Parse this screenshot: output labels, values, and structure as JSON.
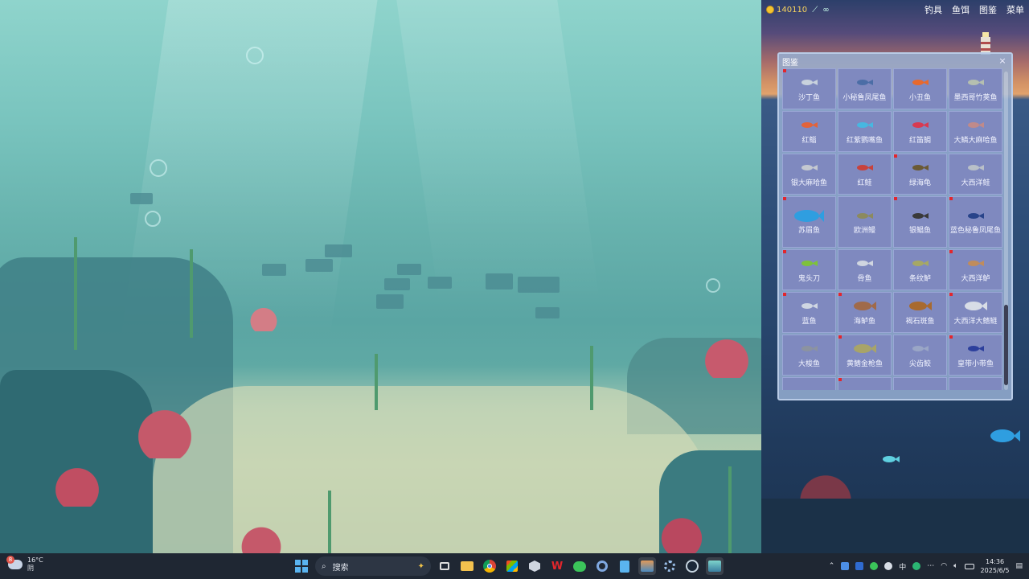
{
  "hud": {
    "gold": "140110",
    "bait_count": "∞",
    "menu": [
      "钓具",
      "鱼饵",
      "图鉴",
      "菜单"
    ]
  },
  "collection": {
    "title": "图鉴",
    "close_label": "×",
    "fish": [
      {
        "name": "沙丁鱼",
        "new": true,
        "icon": "sardine",
        "color": "#c9d2dd"
      },
      {
        "name": "小秘鲁凤尾鱼",
        "new": false,
        "icon": "anchovy",
        "color": "#4b6da6"
      },
      {
        "name": "小丑鱼",
        "new": false,
        "icon": "clownfish",
        "color": "#e8692c"
      },
      {
        "name": "墨西哥竹荚鱼",
        "new": false,
        "icon": "mackerel",
        "color": "#b5bfb0"
      },
      {
        "name": "红鲻",
        "new": false,
        "icon": "red-mullet",
        "color": "#e2633a"
      },
      {
        "name": "红紫鹦嘴鱼",
        "new": false,
        "icon": "parrotfish",
        "color": "#47b7e0"
      },
      {
        "name": "红笛鲷",
        "new": false,
        "icon": "snapper",
        "color": "#d83a52"
      },
      {
        "name": "大鳞大麻哈鱼",
        "new": false,
        "icon": "chinook-salmon",
        "color": "#c08a8a"
      },
      {
        "name": "银大麻哈鱼",
        "new": false,
        "icon": "coho-salmon",
        "color": "#c4c8d0"
      },
      {
        "name": "红鲑",
        "new": false,
        "icon": "sockeye",
        "color": "#c8423c"
      },
      {
        "name": "绿海龟",
        "new": true,
        "icon": "green-turtle",
        "color": "#6b5a34"
      },
      {
        "name": "大西洋鲑",
        "new": false,
        "icon": "atlantic-salmon",
        "color": "#b9c0c8"
      },
      {
        "name": "苏眉鱼",
        "new": true,
        "icon": "napoleon-wrasse",
        "color": "#2f9ee0"
      },
      {
        "name": "欧洲鳗",
        "new": false,
        "icon": "eel",
        "color": "#8c8a5e"
      },
      {
        "name": "银鲳鱼",
        "new": true,
        "icon": "pomfret",
        "color": "#3a3a3a"
      },
      {
        "name": "蓝色秘鲁凤尾鱼",
        "new": true,
        "icon": "blue-anchovy",
        "color": "#28448a"
      },
      {
        "name": "鬼头刀",
        "new": true,
        "icon": "mahi-mahi",
        "color": "#7ec23a"
      },
      {
        "name": "骨鱼",
        "new": false,
        "icon": "bonefish",
        "color": "#d0d6e0"
      },
      {
        "name": "条纹鲈",
        "new": false,
        "icon": "striped-bass",
        "color": "#a6a864"
      },
      {
        "name": "大西洋鲈",
        "new": true,
        "icon": "atlantic-bass",
        "color": "#c08c5c"
      },
      {
        "name": "蓝鱼",
        "new": true,
        "icon": "bluefish",
        "color": "#cfd6e2"
      },
      {
        "name": "海鲈鱼",
        "new": true,
        "icon": "sea-bass",
        "color": "#a06a4a"
      },
      {
        "name": "褐石斑鱼",
        "new": false,
        "icon": "brown-grouper",
        "color": "#a86a2e"
      },
      {
        "name": "大西洋大鳍鲢",
        "new": true,
        "icon": "tarpon",
        "color": "#d8dde6"
      },
      {
        "name": "大梭鱼",
        "new": false,
        "icon": "barracuda",
        "color": "#8c93a0"
      },
      {
        "name": "黄鳍金枪鱼",
        "new": true,
        "icon": "yellowfin-tuna",
        "color": "#a8a468"
      },
      {
        "name": "尖齿鲛",
        "new": false,
        "icon": "needlefish",
        "color": "#9aa6c6"
      },
      {
        "name": "皇带小带鱼",
        "new": true,
        "icon": "ribbonfish",
        "color": "#2c3f9c"
      },
      {
        "name": "",
        "new": false,
        "icon": "partial-fish",
        "color": "#8a6a4a"
      },
      {
        "name": "",
        "new": true,
        "icon": "partial-fish",
        "color": "#4a3a9a"
      },
      {
        "name": "",
        "new": false,
        "icon": "partial-fish",
        "color": "#6a7a8a"
      },
      {
        "name": "",
        "new": false,
        "icon": "partial-fish",
        "color": "#c8d0da"
      }
    ]
  },
  "taskbar": {
    "weather_temp": "16°C",
    "weather_desc": "阴",
    "weather_badge": "8",
    "search_label": "搜索",
    "ime": "中",
    "time": "14:36",
    "date": "2025/6/5"
  }
}
